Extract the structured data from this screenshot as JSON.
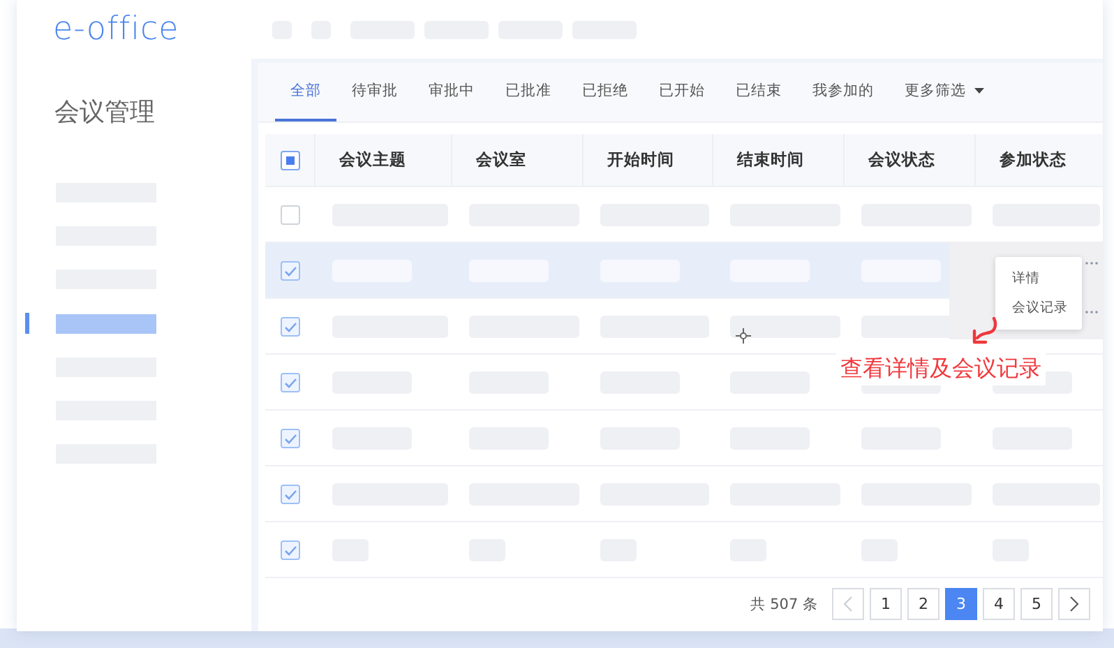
{
  "header": {
    "logo": "e-office"
  },
  "sidebar": {
    "title": "会议管理",
    "items": [
      {
        "selected": false
      },
      {
        "selected": false
      },
      {
        "selected": false
      },
      {
        "selected": true
      },
      {
        "selected": false
      },
      {
        "selected": false
      },
      {
        "selected": false
      }
    ]
  },
  "tabs": [
    {
      "label": "全部",
      "selected": true,
      "kind": "tab"
    },
    {
      "label": "待审批",
      "selected": false,
      "kind": "tab"
    },
    {
      "label": "审批中",
      "selected": false,
      "kind": "tab"
    },
    {
      "label": "已批准",
      "selected": false,
      "kind": "tab"
    },
    {
      "label": "已拒绝",
      "selected": false,
      "kind": "tab"
    },
    {
      "label": "已开始",
      "selected": false,
      "kind": "tab"
    },
    {
      "label": "已结束",
      "selected": false,
      "kind": "tab"
    },
    {
      "label": "我参加的",
      "selected": false,
      "kind": "tab"
    },
    {
      "label": "更多筛选",
      "selected": false,
      "kind": "dropdown"
    }
  ],
  "table": {
    "select_all": {
      "indeterminate": true
    },
    "columns": [
      "会议主题",
      "会议室",
      "开始时间",
      "结束时间",
      "会议状态",
      "参加状态"
    ],
    "rows": [
      {
        "checked": false,
        "selected": false,
        "kind": "long"
      },
      {
        "checked": true,
        "selected": true,
        "kind": "short"
      },
      {
        "checked": true,
        "selected": false,
        "kind": "long"
      },
      {
        "checked": true,
        "selected": false,
        "kind": "short"
      },
      {
        "checked": true,
        "selected": false,
        "kind": "short"
      },
      {
        "checked": true,
        "selected": false,
        "kind": "long"
      },
      {
        "checked": true,
        "selected": false,
        "kind": "tiny"
      }
    ]
  },
  "action_menu": {
    "items": [
      "详情",
      "会议记录"
    ]
  },
  "annotation": "查看详情及会议记录",
  "pagination": {
    "total": "共 507 条",
    "prev": {
      "disabled": true
    },
    "next": {
      "disabled": false
    },
    "pages": [
      {
        "label": "1",
        "selected": false
      },
      {
        "label": "2",
        "selected": false
      },
      {
        "label": "3",
        "selected": true
      },
      {
        "label": "4",
        "selected": false
      },
      {
        "label": "5",
        "selected": false
      }
    ]
  }
}
